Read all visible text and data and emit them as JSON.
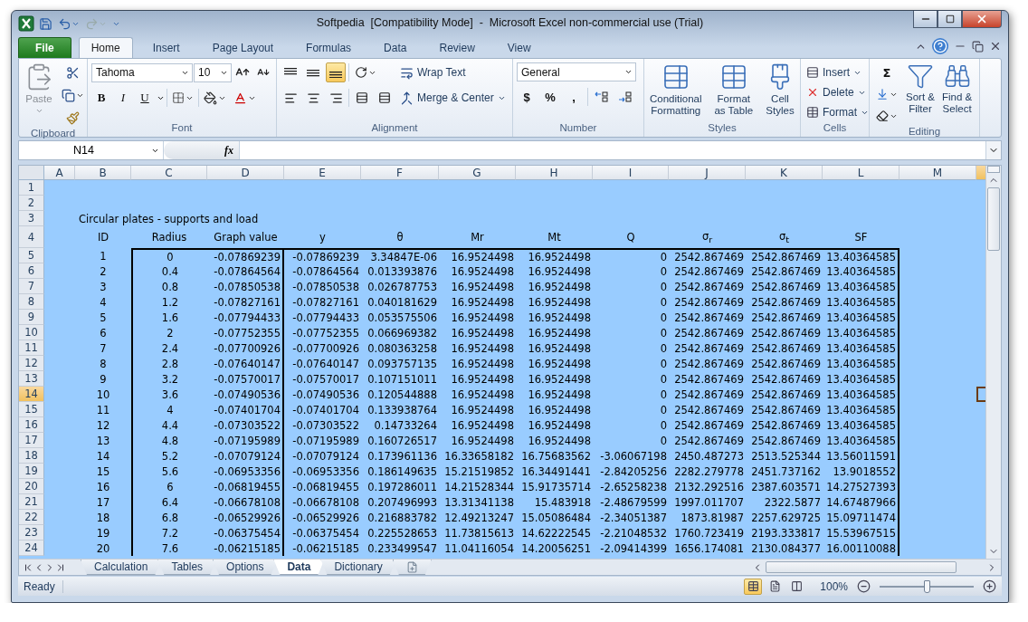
{
  "window": {
    "title": "Softpedia  [Compatibility Mode]  -  Microsoft Excel non-commercial use (Trial)"
  },
  "ribbon_tabs": [
    {
      "label": "File",
      "kind": "file",
      "selected": false
    },
    {
      "label": "Home",
      "kind": "tab",
      "selected": true
    },
    {
      "label": "Insert",
      "kind": "tab",
      "selected": false
    },
    {
      "label": "Page Layout",
      "kind": "tab",
      "selected": false
    },
    {
      "label": "Formulas",
      "kind": "tab",
      "selected": false
    },
    {
      "label": "Data",
      "kind": "tab",
      "selected": false
    },
    {
      "label": "Review",
      "kind": "tab",
      "selected": false
    },
    {
      "label": "View",
      "kind": "tab",
      "selected": false
    }
  ],
  "clipboard": {
    "paste": "Paste",
    "label": "Clipboard"
  },
  "font": {
    "name": "Tahoma",
    "size": "10",
    "style_buttons": [
      "B",
      "I",
      "U"
    ],
    "label": "Font"
  },
  "alignment": {
    "vertical": [
      {
        "selected": false
      },
      {
        "selected": false
      },
      {
        "selected": true
      }
    ],
    "wrap": "Wrap Text",
    "merge": "Merge & Center",
    "label": "Alignment"
  },
  "number": {
    "format": "General",
    "symbols": [
      "$",
      "%",
      ","
    ],
    "label": "Number"
  },
  "styles": {
    "buttons": [
      "Conditional\nFormatting",
      "Format\nas Table",
      "Cell\nStyles"
    ],
    "label": "Styles"
  },
  "cells": {
    "buttons": [
      "Insert",
      "Delete",
      "Format"
    ],
    "label": "Cells"
  },
  "editing": {
    "sum": "Σ",
    "buttons": [
      "Sort &\nFilter",
      "Find &\nSelect"
    ],
    "label": "Editing"
  },
  "formula_bar": {
    "name_box": "N14",
    "fx": "fx"
  },
  "columns": [
    "A",
    "B",
    "C",
    "D",
    "E",
    "F",
    "G",
    "H",
    "I",
    "J",
    "K",
    "L",
    "M"
  ],
  "row_headers": [
    {
      "label": "1",
      "selected": false
    },
    {
      "label": "2",
      "selected": false
    },
    {
      "label": "3",
      "selected": false
    },
    {
      "label": "4",
      "selected": false
    },
    {
      "label": "5",
      "selected": false
    },
    {
      "label": "6",
      "selected": false
    },
    {
      "label": "7",
      "selected": false
    },
    {
      "label": "8",
      "selected": false
    },
    {
      "label": "9",
      "selected": false
    },
    {
      "label": "10",
      "selected": false
    },
    {
      "label": "11",
      "selected": false
    },
    {
      "label": "12",
      "selected": false
    },
    {
      "label": "13",
      "selected": false
    },
    {
      "label": "14",
      "selected": true
    },
    {
      "label": "15",
      "selected": false
    },
    {
      "label": "16",
      "selected": false
    },
    {
      "label": "17",
      "selected": false
    },
    {
      "label": "18",
      "selected": false
    },
    {
      "label": "19",
      "selected": false
    },
    {
      "label": "20",
      "selected": false
    },
    {
      "label": "21",
      "selected": false
    },
    {
      "label": "22",
      "selected": false
    },
    {
      "label": "23",
      "selected": false
    },
    {
      "label": "24",
      "selected": false
    }
  ],
  "sheet_title": "Circular plates - supports and load",
  "headers": [
    "ID",
    "Radius",
    "Graph value",
    "y",
    "θ",
    "Mr",
    "Mt",
    "Q",
    "σ$_{r}$",
    "σ$_{t}$",
    "SF"
  ],
  "data": [
    [
      "1",
      "0",
      "-0.07869239",
      "-0.07869239",
      "3.34847E-06",
      "16.9524498",
      "16.9524498",
      "0",
      "2542.867469",
      "2542.867469",
      "13.40364585"
    ],
    [
      "2",
      "0.4",
      "-0.07864564",
      "-0.07864564",
      "0.013393876",
      "16.9524498",
      "16.9524498",
      "0",
      "2542.867469",
      "2542.867469",
      "13.40364585"
    ],
    [
      "3",
      "0.8",
      "-0.07850538",
      "-0.07850538",
      "0.026787753",
      "16.9524498",
      "16.9524498",
      "0",
      "2542.867469",
      "2542.867469",
      "13.40364585"
    ],
    [
      "4",
      "1.2",
      "-0.07827161",
      "-0.07827161",
      "0.040181629",
      "16.9524498",
      "16.9524498",
      "0",
      "2542.867469",
      "2542.867469",
      "13.40364585"
    ],
    [
      "5",
      "1.6",
      "-0.07794433",
      "-0.07794433",
      "0.053575506",
      "16.9524498",
      "16.9524498",
      "0",
      "2542.867469",
      "2542.867469",
      "13.40364585"
    ],
    [
      "6",
      "2",
      "-0.07752355",
      "-0.07752355",
      "0.066969382",
      "16.9524498",
      "16.9524498",
      "0",
      "2542.867469",
      "2542.867469",
      "13.40364585"
    ],
    [
      "7",
      "2.4",
      "-0.07700926",
      "-0.07700926",
      "0.080363258",
      "16.9524498",
      "16.9524498",
      "0",
      "2542.867469",
      "2542.867469",
      "13.40364585"
    ],
    [
      "8",
      "2.8",
      "-0.07640147",
      "-0.07640147",
      "0.093757135",
      "16.9524498",
      "16.9524498",
      "0",
      "2542.867469",
      "2542.867469",
      "13.40364585"
    ],
    [
      "9",
      "3.2",
      "-0.07570017",
      "-0.07570017",
      "0.107151011",
      "16.9524498",
      "16.9524498",
      "0",
      "2542.867469",
      "2542.867469",
      "13.40364585"
    ],
    [
      "10",
      "3.6",
      "-0.07490536",
      "-0.07490536",
      "0.120544888",
      "16.9524498",
      "16.9524498",
      "0",
      "2542.867469",
      "2542.867469",
      "13.40364585"
    ],
    [
      "11",
      "4",
      "-0.07401704",
      "-0.07401704",
      "0.133938764",
      "16.9524498",
      "16.9524498",
      "0",
      "2542.867469",
      "2542.867469",
      "13.40364585"
    ],
    [
      "12",
      "4.4",
      "-0.07303522",
      "-0.07303522",
      "0.14733264",
      "16.9524498",
      "16.9524498",
      "0",
      "2542.867469",
      "2542.867469",
      "13.40364585"
    ],
    [
      "13",
      "4.8",
      "-0.07195989",
      "-0.07195989",
      "0.160726517",
      "16.9524498",
      "16.9524498",
      "0",
      "2542.867469",
      "2542.867469",
      "13.40364585"
    ],
    [
      "14",
      "5.2",
      "-0.07079124",
      "-0.07079124",
      "0.173961136",
      "16.33658182",
      "16.75683562",
      "-3.06067198",
      "2450.487273",
      "2513.525344",
      "13.56011591"
    ],
    [
      "15",
      "5.6",
      "-0.06953356",
      "-0.06953356",
      "0.186149635",
      "15.21519852",
      "16.34491441",
      "-2.84205256",
      "2282.279778",
      "2451.737162",
      "13.9018552"
    ],
    [
      "16",
      "6",
      "-0.06819455",
      "-0.06819455",
      "0.197286011",
      "14.21528344",
      "15.91735714",
      "-2.65258238",
      "2132.292516",
      "2387.603571",
      "14.27527393"
    ],
    [
      "17",
      "6.4",
      "-0.06678108",
      "-0.06678108",
      "0.207496993",
      "13.31341138",
      "15.483918",
      "-2.48679599",
      "1997.011707",
      "2322.5877",
      "14.67487966"
    ],
    [
      "18",
      "6.8",
      "-0.06529926",
      "-0.06529926",
      "0.216883782",
      "12.49213247",
      "15.05086484",
      "-2.34051387",
      "1873.81987",
      "2257.629725",
      "15.09711474"
    ],
    [
      "19",
      "7.2",
      "-0.06375454",
      "-0.06375454",
      "0.225528653",
      "11.73815613",
      "14.62222545",
      "-2.21048532",
      "1760.723419",
      "2193.333817",
      "15.53967515"
    ],
    [
      "20",
      "7.6",
      "-0.06215185",
      "-0.06215185",
      "0.233499547",
      "11.04116054",
      "14.20056251",
      "-2.09414399",
      "1656.174081",
      "2130.084377",
      "16.00110088"
    ]
  ],
  "sheet_tabs": [
    {
      "label": "Calculation",
      "selected": false
    },
    {
      "label": "Tables",
      "selected": false
    },
    {
      "label": "Options",
      "selected": false
    },
    {
      "label": "Data",
      "selected": true
    },
    {
      "label": "Dictionary",
      "selected": false
    }
  ],
  "status_bar": {
    "text": "Ready",
    "view_buttons": [
      {
        "selected": true
      },
      {
        "selected": false
      },
      {
        "selected": false
      }
    ],
    "zoom": "100%",
    "zoom_slider": {
      "level": 0.5
    }
  }
}
